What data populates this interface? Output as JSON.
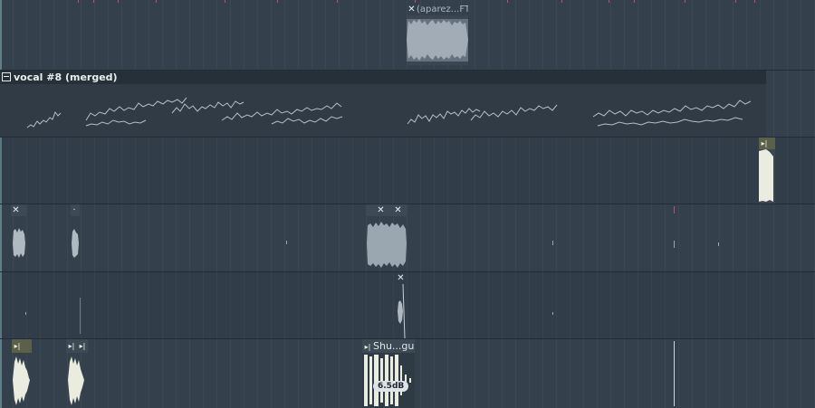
{
  "playlist": {
    "tracks": [
      {
        "index": 1
      },
      {
        "index": 2
      },
      {
        "index": 3
      },
      {
        "index": 4
      },
      {
        "index": 5
      },
      {
        "index": 6
      }
    ]
  },
  "clips": {
    "capa": {
      "label": "(aparez...FT)",
      "icon": "close-icon"
    },
    "vocal": {
      "label": "vocal #8 (merged)",
      "icon": "merge-icon"
    },
    "shu": {
      "label": "Shu...gue",
      "icon": "play-arrow-icon"
    },
    "volume_tag": "6.5dB"
  },
  "colors": {
    "background": "#34414c",
    "clip_dark": "#263038",
    "clip_olive": "#5a6148",
    "wave_light": "#e9ecdf",
    "wave_gray": "#aeb9c2",
    "accent_pink": "#d04a78"
  }
}
